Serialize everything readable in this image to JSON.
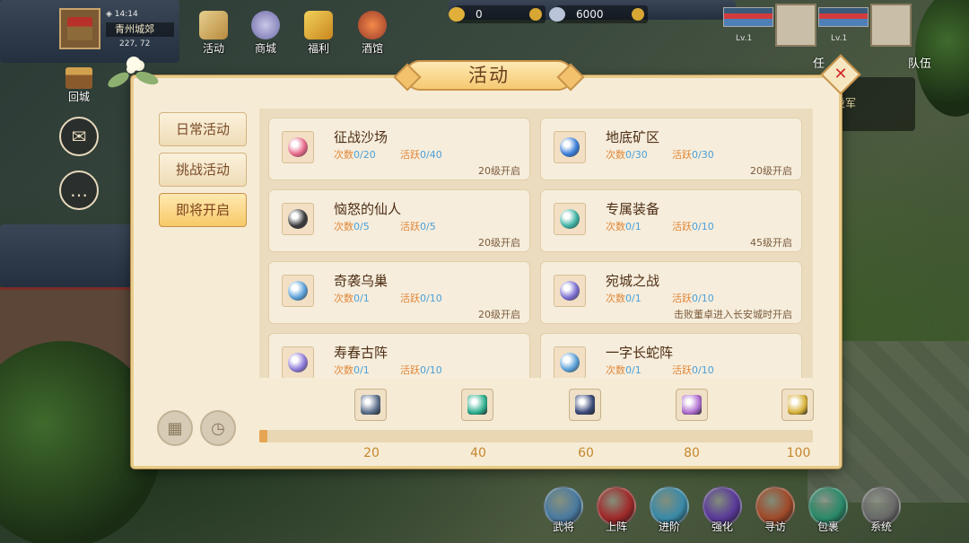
{
  "hud": {
    "time": "14:14",
    "location": "青州城郊",
    "coords": "227, 72",
    "menu": [
      {
        "label": "活动",
        "icon": "scroll-icon"
      },
      {
        "label": "商城",
        "icon": "money-bag-icon"
      },
      {
        "label": "福利",
        "icon": "gift-icon"
      },
      {
        "label": "酒馆",
        "icon": "tavern-icon"
      }
    ],
    "gold": "0",
    "silver": "6000",
    "team": [
      {
        "level": "Lv.1"
      },
      {
        "level": "Lv.1"
      }
    ],
    "quest_tab": "任",
    "team_tab": "队伍",
    "quest_text": "没军",
    "home_label": "回城"
  },
  "dialog": {
    "title": "活动",
    "close_label": "✕",
    "tabs": [
      "日常活动",
      "挑战活动",
      "即将开启"
    ],
    "active_tab": 2,
    "count_prefix": "次数",
    "active_prefix": "活跃",
    "activities": [
      {
        "name": "征战沙场",
        "count": "0/20",
        "active": "0/40",
        "req": "20级开启",
        "color": "#e76a8a"
      },
      {
        "name": "地底矿区",
        "count": "0/30",
        "active": "0/30",
        "req": "20级开启",
        "color": "#3a7ed8"
      },
      {
        "name": "恼怒的仙人",
        "count": "0/5",
        "active": "0/5",
        "req": "20级开启",
        "color": "#3b3b3b"
      },
      {
        "name": "专属装备",
        "count": "0/1",
        "active": "0/10",
        "req": "45级开启",
        "color": "#3fb2a4"
      },
      {
        "name": "奇袭乌巢",
        "count": "0/1",
        "active": "0/10",
        "req": "20级开启",
        "color": "#5aa0d8"
      },
      {
        "name": "宛城之战",
        "count": "0/1",
        "active": "0/10",
        "req": "击败董卓进入长安城时开启",
        "color": "#7b6fd0"
      },
      {
        "name": "寿春古阵",
        "count": "0/1",
        "active": "0/10",
        "req": "",
        "color": "#8e7ad8"
      },
      {
        "name": "一字长蛇阵",
        "count": "0/1",
        "active": "0/10",
        "req": "",
        "color": "#5aa0d8"
      }
    ],
    "rewards": [
      {
        "icon": "disc-icon",
        "color": "#5a6f8a"
      },
      {
        "icon": "jade-pendant-icon",
        "color": "#2fb08f"
      },
      {
        "icon": "crystal-icon",
        "color": "#3b4a7a"
      },
      {
        "icon": "potion-icon",
        "color": "#b06fd0"
      },
      {
        "icon": "gold-pendant-icon",
        "color": "#d8b23a"
      }
    ],
    "milestones": [
      "20",
      "40",
      "60",
      "80",
      "100"
    ],
    "progress": 0.015
  },
  "bottom_menu": [
    {
      "label": "武将",
      "color": "#4a7aa0"
    },
    {
      "label": "上阵",
      "color": "#a02a2a"
    },
    {
      "label": "进阶",
      "color": "#3a8aa8"
    },
    {
      "label": "强化",
      "color": "#5a3a9a"
    },
    {
      "label": "寻访",
      "color": "#a04a2a"
    },
    {
      "label": "包裹",
      "color": "#2a8a6a"
    },
    {
      "label": "系统",
      "color": "#6a6a6a"
    }
  ],
  "colors": {
    "accent": "#f5c972",
    "value_blue": "#4ba0d8",
    "label_orange": "#e0883a",
    "panel": "#f6ecd6"
  }
}
